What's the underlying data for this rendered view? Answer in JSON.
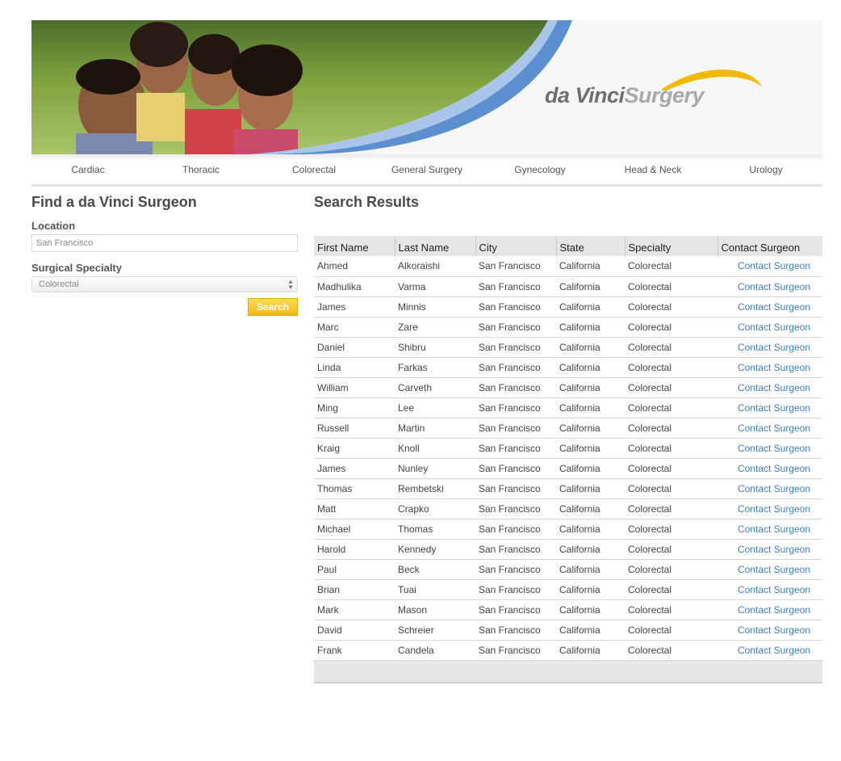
{
  "brand": {
    "logo_part1": "da Vinci",
    "logo_part2": "Surgery"
  },
  "nav": {
    "items": [
      "Cardiac",
      "Thoracic",
      "Colorectal",
      "General Surgery",
      "Gynecology",
      "Head & Neck",
      "Urology"
    ]
  },
  "sidebar": {
    "title": "Find a da Vinci Surgeon",
    "location_label": "Location",
    "location_value": "San Francisco",
    "specialty_label": "Surgical Specialty",
    "specialty_value": "Colorectal",
    "search_label": "Search"
  },
  "results": {
    "title": "Search Results",
    "columns": [
      "First Name",
      "Last Name",
      "City",
      "State",
      "Specialty",
      "Contact Surgeon"
    ],
    "contact_label": "Contact Surgeon",
    "rows": [
      [
        "Ahmed",
        "Alkoraishi",
        "San Francisco",
        "California",
        "Colorectal"
      ],
      [
        "Madhulika",
        "Varma",
        "San Francisco",
        "California",
        "Colorectal"
      ],
      [
        "James",
        "Minnis",
        "San Francisco",
        "California",
        "Colorectal"
      ],
      [
        "Marc",
        "Zare",
        "San Francisco",
        "California",
        "Colorectal"
      ],
      [
        "Daniel",
        "Shibru",
        "San Francisco",
        "California",
        "Colorectal"
      ],
      [
        "Linda",
        "Farkas",
        "San Francisco",
        "California",
        "Colorectal"
      ],
      [
        "William",
        "Carveth",
        "San Francisco",
        "California",
        "Colorectal"
      ],
      [
        "Ming",
        "Lee",
        "San Francisco",
        "California",
        "Colorectal"
      ],
      [
        "Russell",
        "Martin",
        "San Francisco",
        "California",
        "Colorectal"
      ],
      [
        "Kraig",
        "Knoll",
        "San Francisco",
        "California",
        "Colorectal"
      ],
      [
        "James",
        "Nunley",
        "San Francisco",
        "California",
        "Colorectal"
      ],
      [
        "Thomas",
        "Rembetski",
        "San Francisco",
        "California",
        "Colorectal"
      ],
      [
        "Matt",
        "Crapko",
        "San Francisco",
        "California",
        "Colorectal"
      ],
      [
        "Michael",
        "Thomas",
        "San Francisco",
        "California",
        "Colorectal"
      ],
      [
        "Harold",
        "Kennedy",
        "San Francisco",
        "California",
        "Colorectal"
      ],
      [
        "Paul",
        "Beck",
        "San Francisco",
        "California",
        "Colorectal"
      ],
      [
        "Brian",
        "Tuai",
        "San Francisco",
        "California",
        "Colorectal"
      ],
      [
        "Mark",
        "Mason",
        "San Francisco",
        "California",
        "Colorectal"
      ],
      [
        "David",
        "Schreier",
        "San Francisco",
        "California",
        "Colorectal"
      ],
      [
        "Frank",
        "Candela",
        "San Francisco",
        "California",
        "Colorectal"
      ]
    ]
  },
  "colors": {
    "accent_blue": "#3d7fbf",
    "button_yellow": "#f6b81a",
    "logo_swoosh": "#f5b800",
    "banner_wave": "#5b8fcf"
  }
}
